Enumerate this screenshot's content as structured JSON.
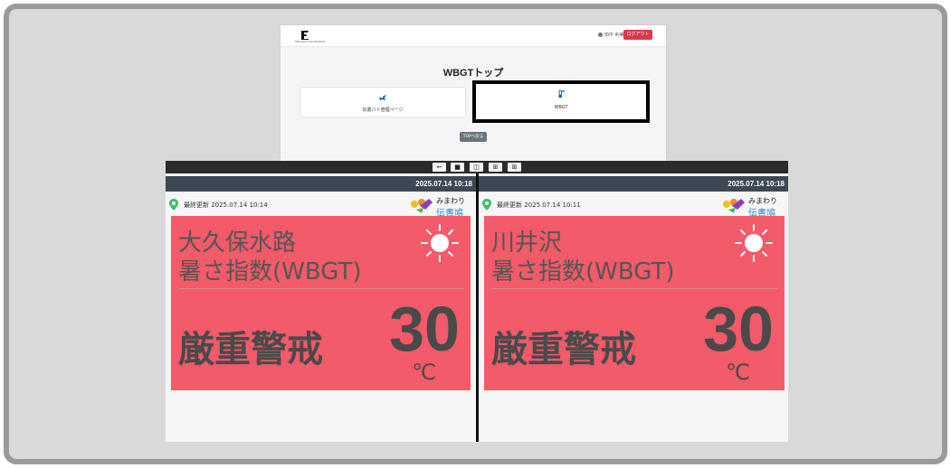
{
  "top_page": {
    "logo_small_text": "Mimawari Denshobato",
    "user_name": "田中 利美",
    "logout_label": "ログアウト",
    "title": "WBGTトップ",
    "cards": [
      {
        "label": "伝書バト管理ページ",
        "icon": "bird-icon"
      },
      {
        "label": "WBGT",
        "icon": "thermometer-icon"
      }
    ],
    "back_button": "TOPへ戻る"
  },
  "toolbar": {
    "buttons": [
      {
        "label": "←",
        "icon": "back-arrow-icon"
      },
      {
        "label": "■",
        "icon": "single-view-icon"
      },
      {
        "label": "◫",
        "icon": "split-view-icon"
      },
      {
        "label": "⊞",
        "icon": "grid-view-icon"
      },
      {
        "label": "⊞",
        "icon": "grid-view-alt-icon"
      }
    ]
  },
  "panels": [
    {
      "clock": "2025.07.14 10:18",
      "updated": "最終更新 2025.07.14 10:14",
      "brand_line1": "みまわり",
      "brand_line2": "伝書鳩",
      "place": "大久保水路",
      "subtitle": "暑さ指数(WBGT)",
      "level": "厳重警戒",
      "value": "30",
      "unit": "℃",
      "alert_color": "#f35a6a"
    },
    {
      "clock": "2025.07.14 10:18",
      "updated": "最終更新 2025.07.14 10:11",
      "brand_line1": "みまわり",
      "brand_line2": "伝書鳩",
      "place": "川井沢",
      "subtitle": "暑さ指数(WBGT)",
      "level": "厳重警戒",
      "value": "30",
      "unit": "℃",
      "alert_color": "#f35a6a"
    }
  ]
}
